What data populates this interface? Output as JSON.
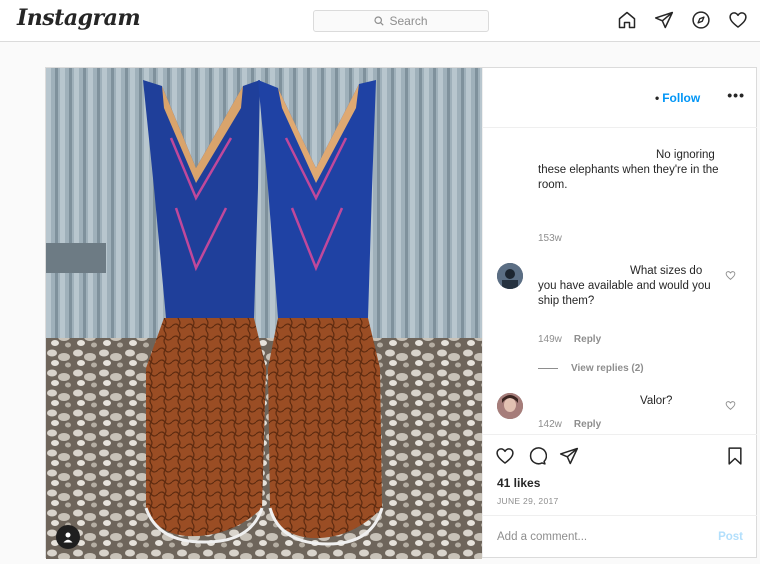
{
  "header": {
    "logo": "Instagram",
    "search_placeholder": "Search",
    "nav_icons": [
      "home-icon",
      "direct-icon",
      "explore-icon",
      "activity-icon"
    ]
  },
  "post": {
    "follow_label": "Follow",
    "more_label": "•••",
    "caption": "No ignoring these elephants when they're in the room.",
    "caption_age": "153w",
    "comments": [
      {
        "text": "What sizes do you have available and would you ship them?",
        "age": "149w",
        "reply_label": "Reply",
        "view_replies": "View replies (2)"
      },
      {
        "text": "Valor?",
        "age": "142w",
        "reply_label": "Reply"
      }
    ],
    "likes": "41 likes",
    "date": "JUNE 29, 2017",
    "comment_placeholder": "Add a comment...",
    "post_label": "Post"
  },
  "colors": {
    "accent": "#0095f6",
    "post_disabled": "#b2dffc",
    "muted": "#8e8e8e",
    "border": "#dbdbdb"
  }
}
